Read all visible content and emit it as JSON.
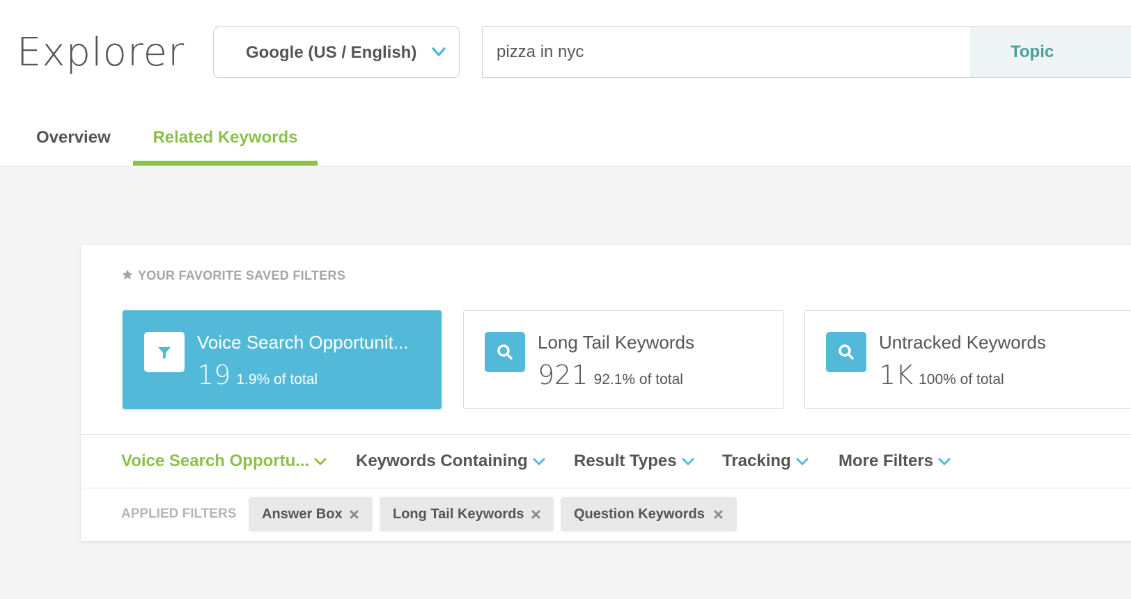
{
  "header": {
    "title": "Explorer",
    "engine_select": {
      "value": "Google (US / English)"
    },
    "search": {
      "value": "pizza in nyc",
      "mode_label": "Topic"
    }
  },
  "tabs": [
    {
      "label": "Overview",
      "active": false
    },
    {
      "label": "Related Keywords",
      "active": true
    }
  ],
  "saved_filters": {
    "heading": "YOUR FAVORITE SAVED FILTERS",
    "cards": [
      {
        "title": "Voice Search Opportunit...",
        "count": "19",
        "percent": "1.9% of total",
        "icon": "filter-icon",
        "active": true
      },
      {
        "title": "Long Tail Keywords",
        "count": "921",
        "percent": "92.1% of total",
        "icon": "search-icon",
        "active": false
      },
      {
        "title": "Untracked Keywords",
        "count": "1K",
        "percent": "100% of total",
        "icon": "search-icon",
        "active": false
      }
    ]
  },
  "filter_bar": {
    "items": [
      {
        "label": "Voice Search Opportu...",
        "active": true
      },
      {
        "label": "Keywords Containing",
        "active": false
      },
      {
        "label": "Result Types",
        "active": false
      },
      {
        "label": "Tracking",
        "active": false
      },
      {
        "label": "More Filters",
        "active": false
      }
    ]
  },
  "applied_filters": {
    "label": "APPLIED FILTERS",
    "chips": [
      {
        "label": "Answer Box"
      },
      {
        "label": "Long Tail Keywords"
      },
      {
        "label": "Question Keywords"
      }
    ]
  },
  "colors": {
    "accent_green": "#8cc04b",
    "accent_blue": "#53b9d8",
    "teal_text": "#4a9e9b",
    "text": "#555555"
  }
}
